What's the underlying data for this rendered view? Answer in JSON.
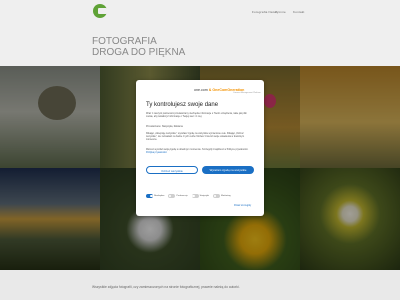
{
  "nav": {
    "items": [
      "Fotografia Natury",
      "O mnie",
      "Kontakt"
    ]
  },
  "hero": {
    "line1": "FOTOGRAFIA",
    "line2": "DROGA DO PIĘKNA"
  },
  "consent": {
    "brand_name": "one.com",
    "brand_partner": "& OneComOneration",
    "brand_tag": "Consent Management Platform",
    "title": "Ty kontrolujesz swoje dane",
    "para1": "Wraz z naszymi partnerami przetwarzamy niezbędne informacje o Twoim urządzeniu, takie jak pliki cookie, aby świadczyć informacje o Twojej sieci i z niej.",
    "para2": "Przetwarzanie: Statystyka, Reklama",
    "para3": "Klikając „Akceptuję wszystkie”, wyrażasz zgodę na wszystkie wymienione cele. Klikając „Odrzuć wszystkie”, nie zezwalasz na żadne z tych celów. Możesz zmienić swoje ustawienia w dowolnym momencie.",
    "para4": "Możesz wycofać swoją zgodę w dowolnym momencie. Szczegóły znajdziesz w Polityce prywatności.",
    "link_label": "Polityka prywatności",
    "reject_label": "Odrzuć wszystkie",
    "accept_label": "Wyrażam zgodę na wszystkie",
    "options": [
      {
        "label": "Niezbędne",
        "on": true
      },
      {
        "label": "Preferencje",
        "on": false
      },
      {
        "label": "Statystyki",
        "on": false
      },
      {
        "label": "Marketing",
        "on": false
      }
    ],
    "details_label": "Pokaż szczegóły"
  },
  "footer": {
    "text": "Wszystkie zdjęcia fotografii, czy zamieszczonych na stronie fotograficznej, prawnie należą do autorki."
  },
  "colors": {
    "accent": "#1a6fc4",
    "brand_green": "#5fa236",
    "brand_orange": "#f39200"
  }
}
